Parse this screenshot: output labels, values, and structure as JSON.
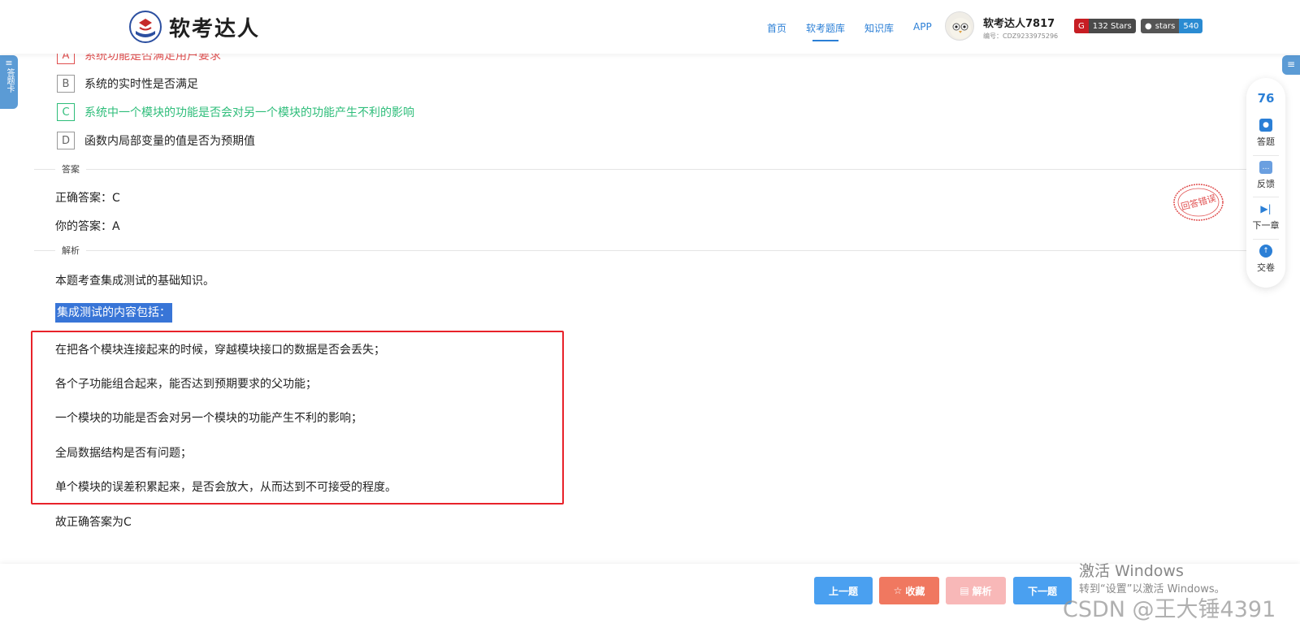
{
  "header": {
    "logo_text": "软考达人",
    "nav": [
      "首页",
      "软考题库",
      "知识库",
      "APP"
    ],
    "active_nav_index": 1,
    "user": {
      "name": "软考达人7817",
      "id": "编号：CDZ9233975296"
    },
    "badges": {
      "gitee_label": "132 Stars",
      "github_label": "stars",
      "github_count": "540"
    }
  },
  "side_tabs": {
    "left_label": "答题卡"
  },
  "options": [
    {
      "letter": "A",
      "text": "系统功能是否满足用户要求",
      "state": "wrong"
    },
    {
      "letter": "B",
      "text": "系统的实时性是否满足",
      "state": "normal"
    },
    {
      "letter": "C",
      "text": "系统中一个模块的功能是否会对另一个模块的功能产生不利的影响",
      "state": "right"
    },
    {
      "letter": "D",
      "text": "函数内局部变量的值是否为预期值",
      "state": "normal"
    }
  ],
  "answer": {
    "section_label": "答案",
    "correct": "正确答案：C",
    "yours": "你的答案：A"
  },
  "analysis": {
    "section_label": "解析",
    "intro": "本题考查集成测试的基础知识。",
    "heading": "集成测试的内容包括：",
    "points": [
      "在把各个模块连接起来的时候，穿越模块接口的数据是否会丢失；",
      "各个子功能组合起来，能否达到预期要求的父功能；",
      "一个模块的功能是否会对另一个模块的功能产生不利的影响；",
      "全局数据结构是否有问题；",
      "单个模块的误差积累起来，是否会放大，从而达到不可接受的程度。"
    ],
    "conclusion": "故正确答案为C"
  },
  "stamp_text": "回答错误",
  "float_panel": {
    "score": "76",
    "items": [
      "答题",
      "反馈",
      "下一章",
      "交卷"
    ]
  },
  "bottom": {
    "prev": "上一题",
    "favorite": "收藏",
    "analysis": "解析",
    "next": "下一题"
  },
  "watermarks": {
    "activate_title": "激活 Windows",
    "activate_sub": "转到“设置”以激活 Windows。",
    "csdn": "CSDN @王大锤4391"
  },
  "colors": {
    "accent": "#2b7fd6",
    "wrong": "#e05050",
    "right": "#2ebd7a",
    "box": "#e8222a"
  }
}
